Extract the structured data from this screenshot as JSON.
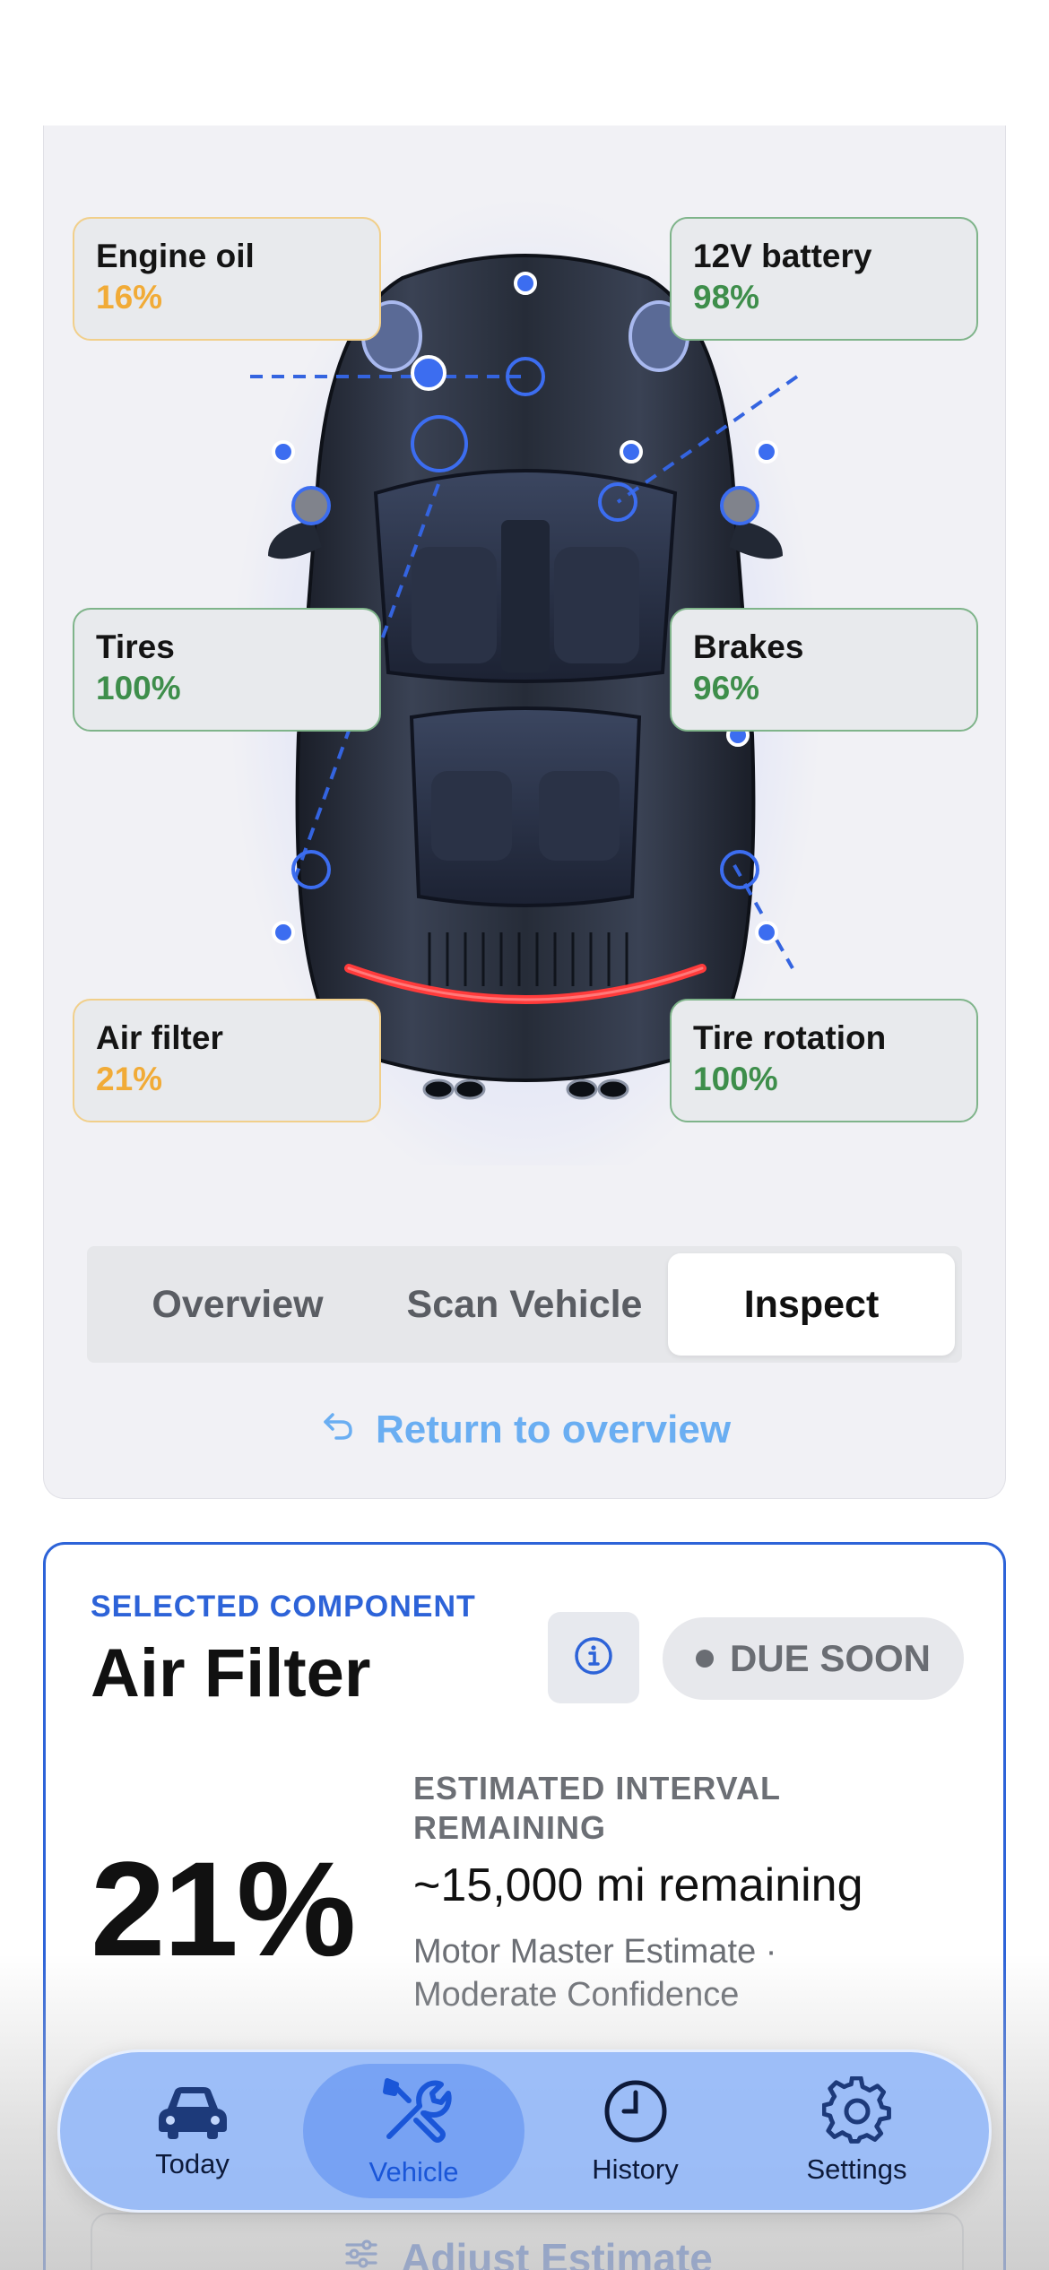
{
  "metrics": {
    "engine_oil": {
      "label": "Engine oil",
      "value": "16%"
    },
    "battery": {
      "label": "12V battery",
      "value": "98%"
    },
    "tires": {
      "label": "Tires",
      "value": "100%"
    },
    "brakes": {
      "label": "Brakes",
      "value": "96%"
    },
    "air_filter": {
      "label": "Air filter",
      "value": "21%"
    },
    "tire_rotation": {
      "label": "Tire rotation",
      "value": "100%"
    }
  },
  "segmented": {
    "tabs": [
      "Overview",
      "Scan Vehicle",
      "Inspect"
    ],
    "selected": "Inspect"
  },
  "return_link": {
    "label": "Return to overview",
    "icon": "return-arrow-icon"
  },
  "component": {
    "eyebrow": "SELECTED COMPONENT",
    "title": "Air Filter",
    "status": "DUE SOON",
    "percent": "21%",
    "interval_label": "ESTIMATED INTERVAL REMAINING",
    "interval_value": "~15,000 mi remaining",
    "source": "Motor Master Estimate · Moderate Confidence",
    "adjust_label": "Adjust Estimate"
  },
  "tab_bar": {
    "items": [
      {
        "label": "Today",
        "icon": "car-icon"
      },
      {
        "label": "Vehicle",
        "icon": "tools-icon"
      },
      {
        "label": "History",
        "icon": "clock-icon"
      },
      {
        "label": "Settings",
        "icon": "gear-icon"
      }
    ],
    "selected": "Vehicle"
  },
  "colors": {
    "accent": "#2d63d8",
    "ok": "#3e8e4b",
    "warn": "#f1ab37",
    "link": "#6aaef2"
  }
}
